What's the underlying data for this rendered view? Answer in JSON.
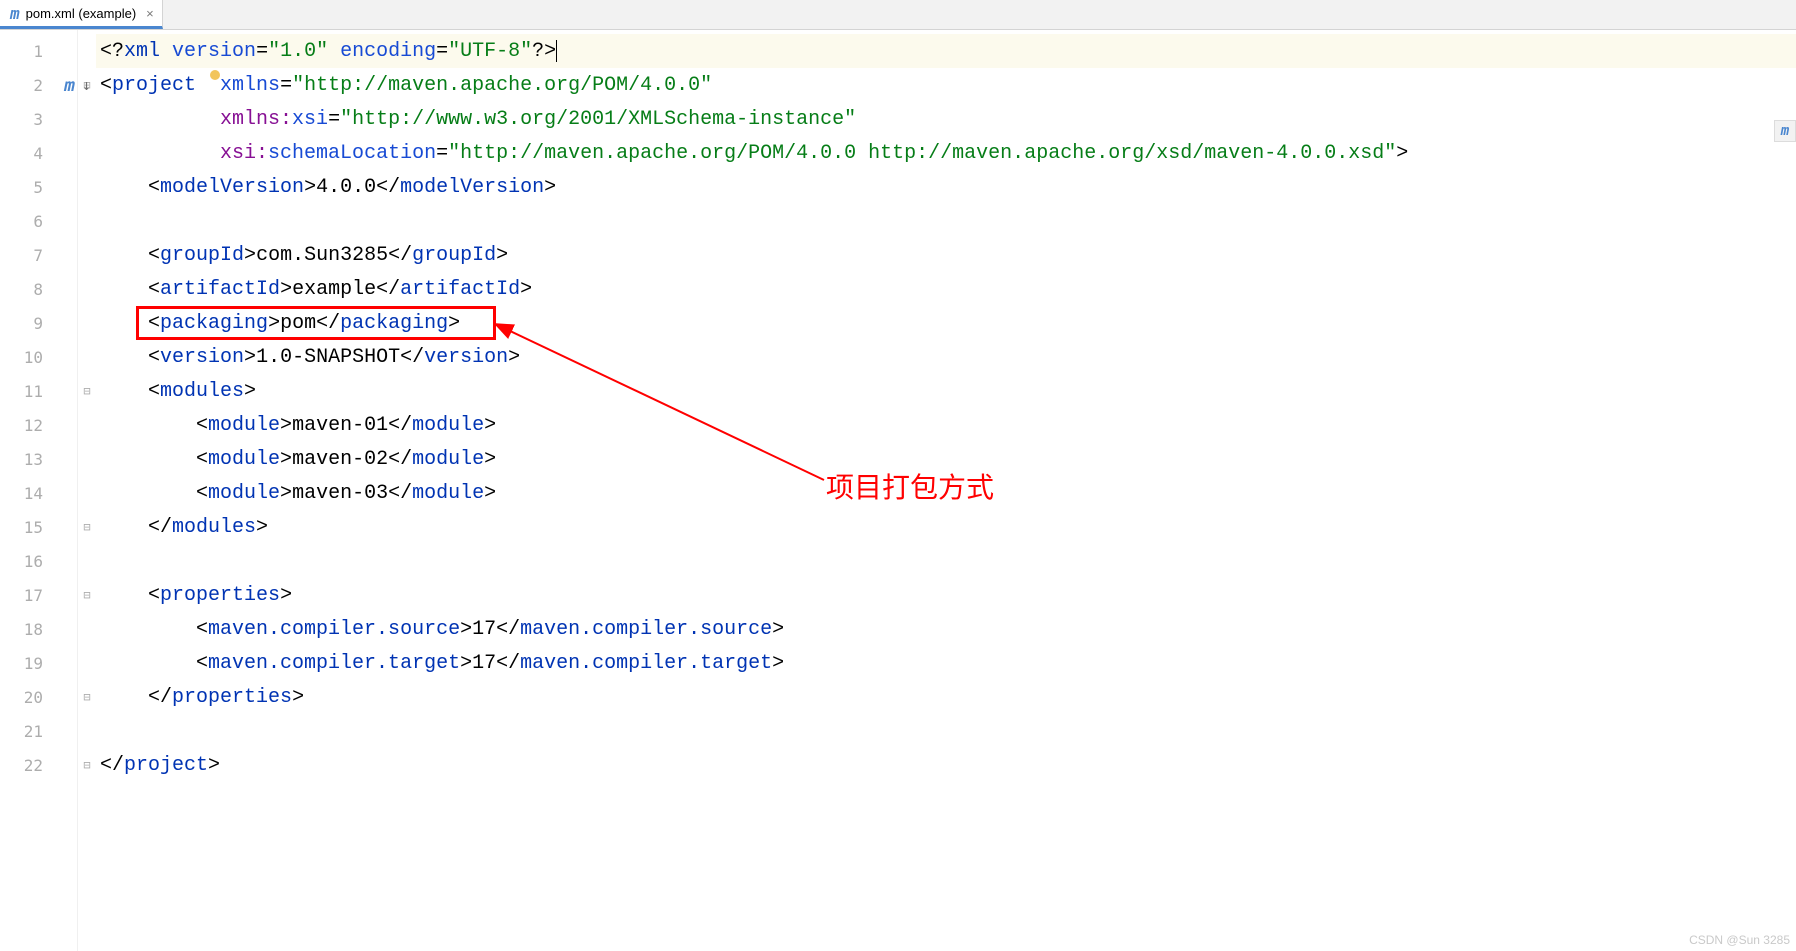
{
  "tab": {
    "icon": "m",
    "label": "pom.xml (example)",
    "close": "×"
  },
  "gutter": {
    "line_count": 22,
    "maven_icon": "m",
    "arrow": "↓"
  },
  "fold_marks": {
    "2": "⊟",
    "11": "⊟",
    "15": "⊟",
    "17": "⊟",
    "20": "⊟",
    "22": "⊟"
  },
  "code": {
    "l1": {
      "p": "<?",
      "t": "xml",
      "sp": " ",
      "a1": "version",
      "eq": "=",
      "v1": "\"1.0\"",
      "sp2": " ",
      "a2": "encoding",
      "v2": "\"UTF-8\"",
      "end": "?>"
    },
    "l2": {
      "open": "<",
      "tag": "project",
      "sp": "  ",
      "a": "xmlns",
      "eq": "=",
      "v": "\"http://maven.apache.org/POM/4.0.0\""
    },
    "l3": {
      "pad": "          ",
      "ns": "xmlns:",
      "a": "xsi",
      "eq": "=",
      "v": "\"http://www.w3.org/2001/XMLSchema-instance\""
    },
    "l4": {
      "pad": "          ",
      "ns": "xsi:",
      "a": "schemaLocation",
      "eq": "=",
      "v": "\"http://maven.apache.org/POM/4.0.0 http://maven.apache.org/xsd/maven-4.0.0.xsd\"",
      "end": ">"
    },
    "l5": {
      "pad": "    ",
      "o": "<",
      "t": "modelVersion",
      "c": ">",
      "txt": "4.0.0",
      "o2": "</",
      "c2": ">"
    },
    "l7": {
      "pad": "    ",
      "o": "<",
      "t": "groupId",
      "c": ">",
      "txt": "com.Sun3285",
      "o2": "</",
      "c2": ">"
    },
    "l8": {
      "pad": "    ",
      "o": "<",
      "t": "artifactId",
      "c": ">",
      "txt": "example",
      "o2": "</",
      "c2": ">"
    },
    "l9": {
      "pad": "    ",
      "o": "<",
      "t": "packaging",
      "c": ">",
      "txt": "pom",
      "o2": "</",
      "c2": ">"
    },
    "l10": {
      "pad": "    ",
      "o": "<",
      "t": "version",
      "c": ">",
      "txt": "1.0-SNAPSHOT",
      "o2": "</",
      "c2": ">"
    },
    "l11": {
      "pad": "    ",
      "o": "<",
      "t": "modules",
      "c": ">"
    },
    "l12": {
      "pad": "        ",
      "o": "<",
      "t": "module",
      "c": ">",
      "txt": "maven-01",
      "o2": "</",
      "c2": ">"
    },
    "l13": {
      "pad": "        ",
      "o": "<",
      "t": "module",
      "c": ">",
      "txt": "maven-02",
      "o2": "</",
      "c2": ">"
    },
    "l14": {
      "pad": "        ",
      "o": "<",
      "t": "module",
      "c": ">",
      "txt": "maven-03",
      "o2": "</",
      "c2": ">"
    },
    "l15": {
      "pad": "    ",
      "o": "</",
      "t": "modules",
      "c": ">"
    },
    "l17": {
      "pad": "    ",
      "o": "<",
      "t": "properties",
      "c": ">"
    },
    "l18": {
      "pad": "        ",
      "o": "<",
      "t": "maven.compiler.source",
      "c": ">",
      "txt": "17",
      "o2": "</",
      "c2": ">"
    },
    "l19": {
      "pad": "        ",
      "o": "<",
      "t": "maven.compiler.target",
      "c": ">",
      "txt": "17",
      "o2": "</",
      "c2": ">"
    },
    "l20": {
      "pad": "    ",
      "o": "</",
      "t": "properties",
      "c": ">"
    },
    "l22": {
      "o": "</",
      "t": "project",
      "c": ">"
    }
  },
  "annotation": {
    "label": "项目打包方式"
  },
  "watermark": "CSDN @Sun 3285",
  "right_icon": "m"
}
